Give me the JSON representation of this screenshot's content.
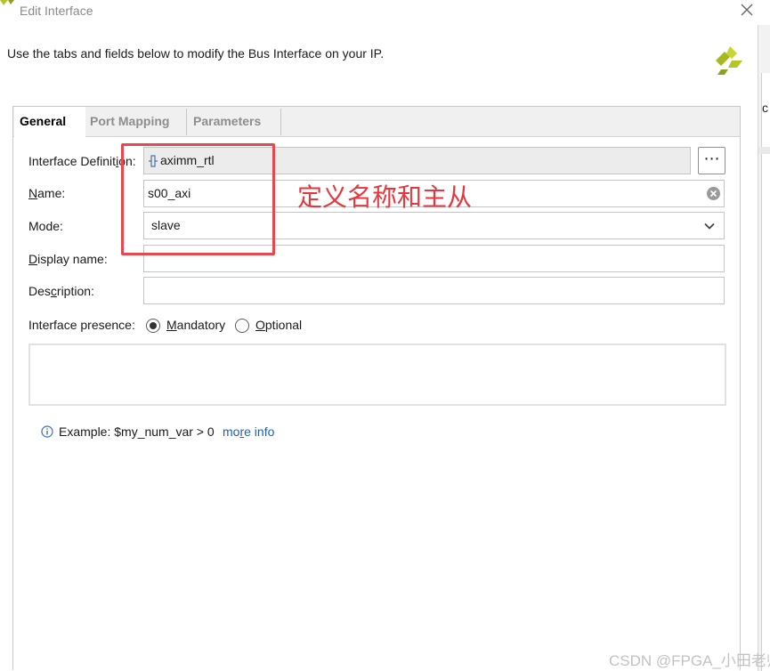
{
  "window": {
    "title": "Edit Interface",
    "close_icon": "close-icon"
  },
  "instruction": "Use the tabs and fields below to modify the Bus Interface on your IP.",
  "tabs": [
    {
      "label": "General",
      "active": true
    },
    {
      "label": "Port Mapping",
      "active": false
    },
    {
      "label": "Parameters",
      "active": false
    }
  ],
  "form": {
    "interface_definition": {
      "label_pre": "Interface Definit",
      "label_u": "i",
      "label_post": "on:",
      "value": "aximm_rtl",
      "icon": "bus-interface-icon",
      "browse_label": "⋯"
    },
    "name": {
      "label_u": "N",
      "label_post": "ame:",
      "value": "s00_axi"
    },
    "mode": {
      "label": "Mode:",
      "value": "slave"
    },
    "display_name": {
      "label_u": "D",
      "label_post": "isplay name:",
      "value": ""
    },
    "description": {
      "label_pre": "Des",
      "label_u": "c",
      "label_post": "ription:",
      "value": ""
    },
    "presence": {
      "label": "Interface presence:",
      "options": [
        {
          "label_u": "M",
          "label_post": "andatory",
          "checked": true
        },
        {
          "label_u": "O",
          "label_post": "ptional",
          "checked": false
        }
      ]
    }
  },
  "example": {
    "text": "Example:  $my_num_var > 0",
    "link_pre": "mo",
    "link_u": "r",
    "link_post": "e info"
  },
  "annotation": {
    "text": "定义名称和主从",
    "color": "#e8363c"
  },
  "watermark": "CSDN @FPGA_小田老师",
  "right_strip_char": "c",
  "colors": {
    "highlight": "#e8474d",
    "link": "#1f5fbf",
    "logo": "#b5c427"
  }
}
